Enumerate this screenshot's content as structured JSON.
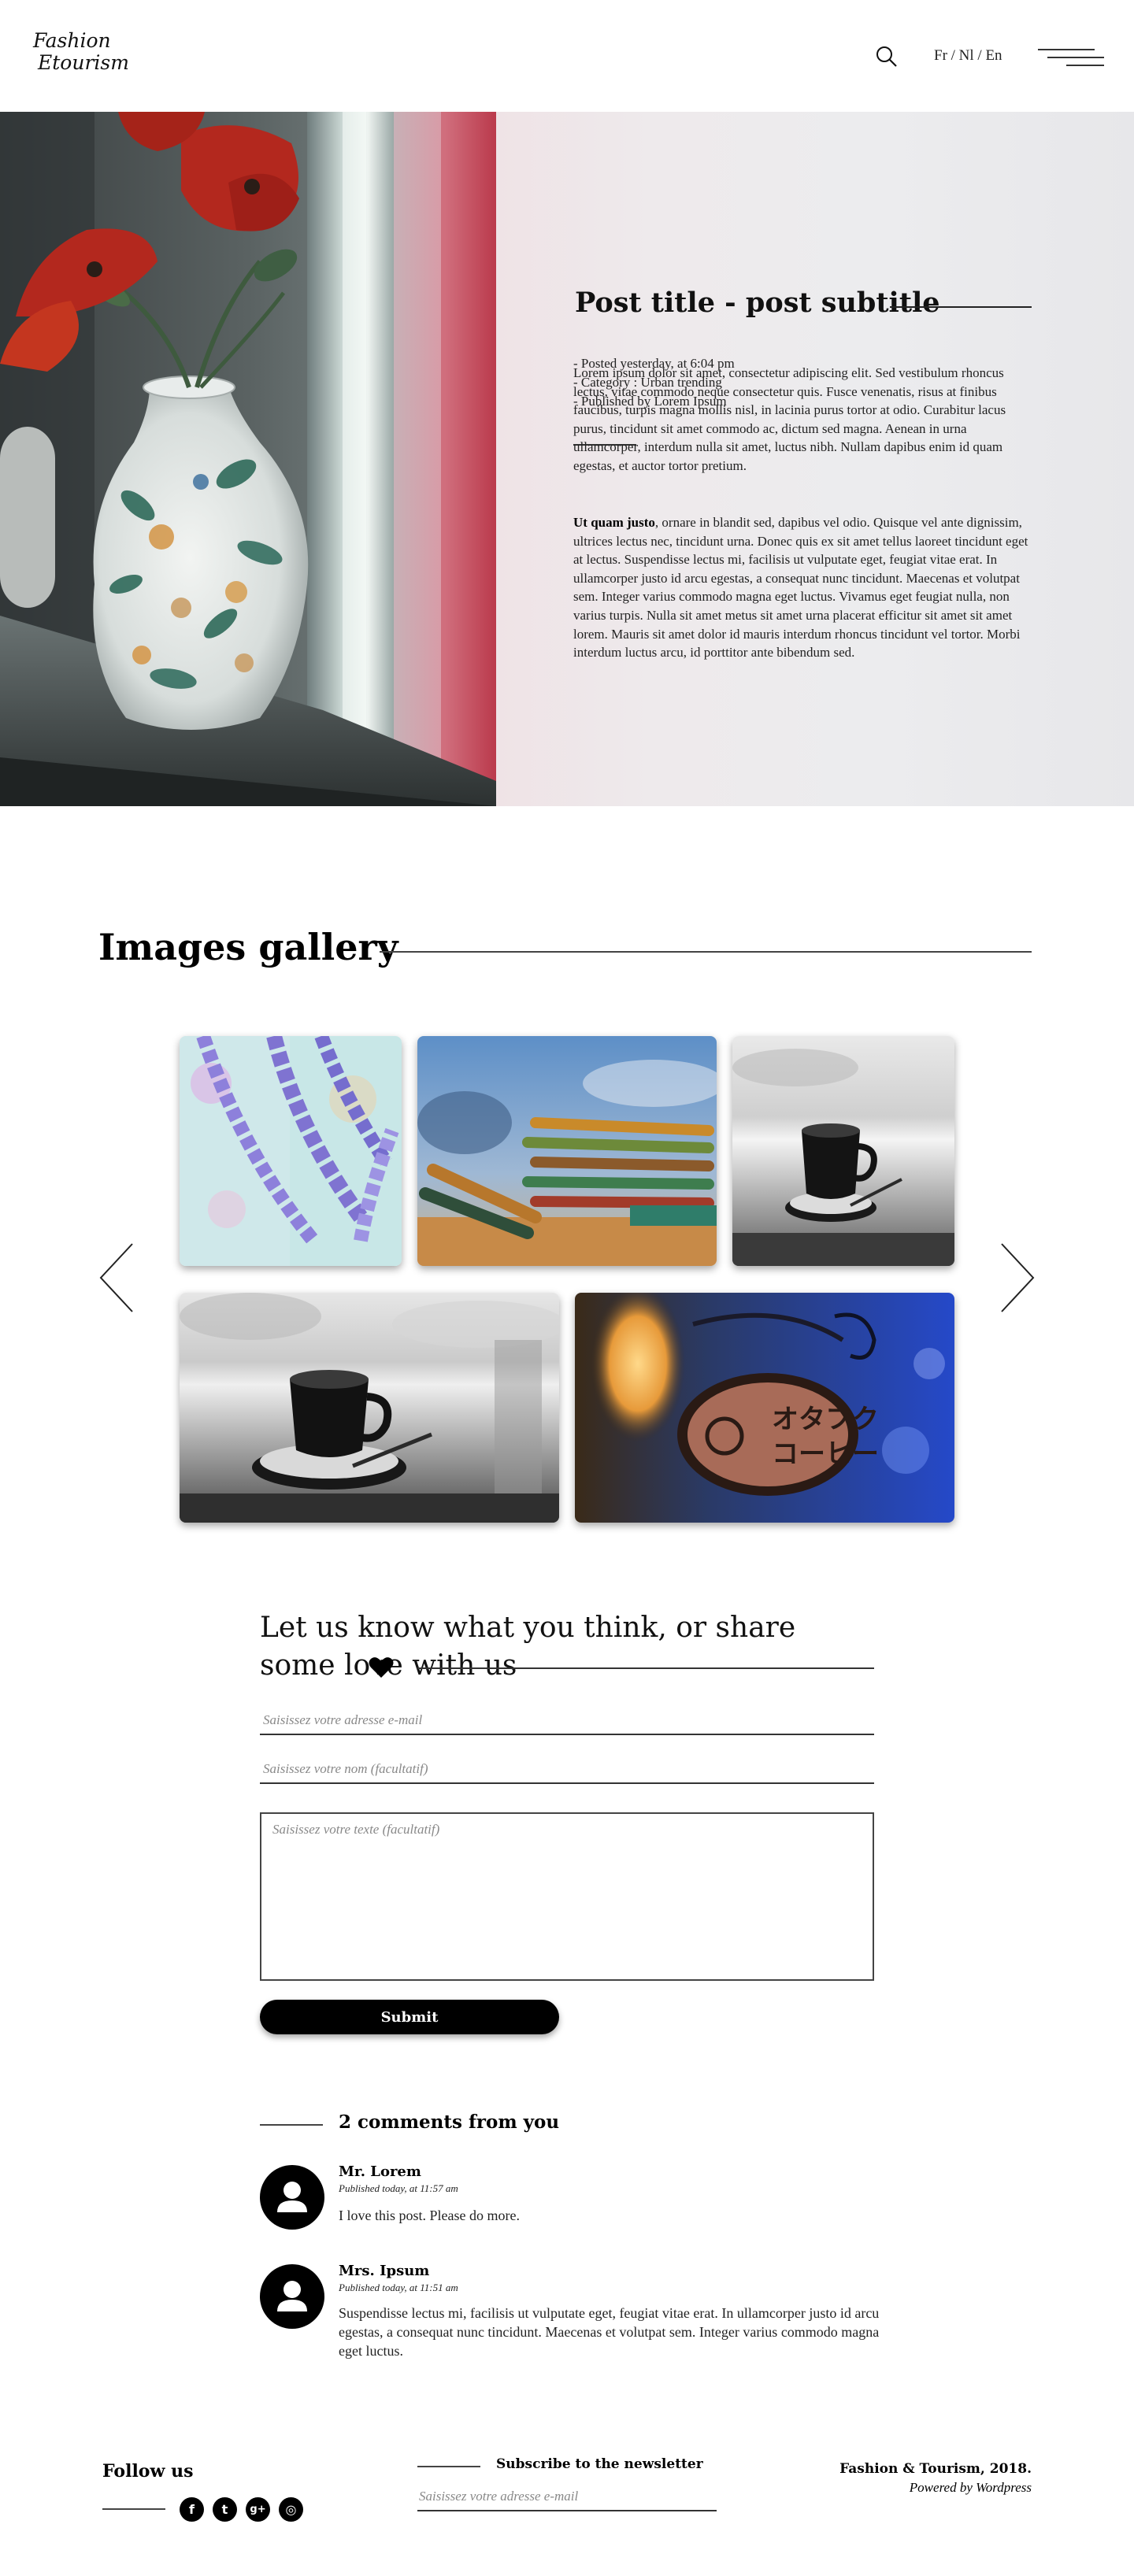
{
  "header": {
    "logo_line1": "Fashion",
    "logo_line2": "Etourism",
    "search_icon": "search-icon",
    "lang": "Fr / Nl / En",
    "menu_icon": "hamburger-menu-icon"
  },
  "post": {
    "title": "Post title - post subtitle",
    "meta": [
      "- Posted yesterday, at 6:04 pm",
      "- Category : Urban trending",
      "- Published by Lorem Ipsum"
    ],
    "paragraph1": "Lorem ipsum dolor sit amet, consectetur adipiscing elit. Sed vestibulum rhoncus lectus, vitae commodo neque consectetur quis. Fusce venenatis, risus at finibus faucibus, turpis magna mollis nisl, in lacinia purus tortor at odio. Curabitur lacus purus, tincidunt sit amet commodo ac, dictum sed magna. Aenean in urna ullamcorper, interdum nulla sit amet, luctus nibh. Nullam dapibus enim id quam egestas, et auctor tortor pretium.",
    "paragraph2_bold": "Ut quam justo",
    "paragraph2": ", ornare in blandit sed, dapibus vel odio. Quisque vel ante dignissim, ultrices lectus nec, tincidunt urna. Donec quis ex sit amet tellus laoreet tincidunt eget at lectus. Suspendisse lectus mi, facilisis ut vulputate eget, feugiat vitae erat. In ullamcorper justo id arcu egestas, a consequat nunc tincidunt. Maecenas et volutpat sem. Integer varius commodo magna eget luctus. Vivamus eget feugiat nulla, non varius turpis. Nulla sit amet metus sit amet urna placerat efficitur sit amet sit amet lorem. Mauris sit amet dolor id mauris interdum rhoncus tincidunt vel tortor. Morbi interdum luctus arcu, id porttitor ante bibendum sed."
  },
  "gallery": {
    "title": "Images gallery",
    "prev_icon": "chevron-left-icon",
    "next_icon": "chevron-right-icon",
    "images": [
      "purple beads necklace",
      "colored pencils",
      "coffee cup black and white",
      "coffee cup black and white",
      "coffee shop sign"
    ],
    "sign_text_line1": "オタフク",
    "sign_text_line2": "コーヒー"
  },
  "comment_form": {
    "title": "Let us know what you think, or share some love with us",
    "heart_icon": "heart-icon",
    "email_placeholder": "Saisissez votre adresse e-mail",
    "name_placeholder": "Saisissez votre nom (facultatif)",
    "text_placeholder": "Saisissez votre texte (facultatif)",
    "submit_label": "Submit"
  },
  "comments": {
    "title": "2 comments from you",
    "items": [
      {
        "name": "Mr. Lorem",
        "date": "Published today, at 11:57 am",
        "text": "I love this post. Please do more."
      },
      {
        "name": "Mrs. Ipsum",
        "date": "Published today, at 11:51 am",
        "text": "Suspendisse lectus mi, facilisis ut vulputate eget, feugiat vitae erat. In ullamcorper justo id arcu egestas, a consequat nunc tincidunt. Maecenas et volutpat sem. Integer varius commodo magna eget luctus."
      }
    ]
  },
  "footer": {
    "follow_title": "Follow us",
    "social": [
      {
        "icon": "facebook-icon",
        "glyph": "f"
      },
      {
        "icon": "twitter-icon",
        "glyph": "t"
      },
      {
        "icon": "google-plus-icon",
        "glyph": "g+"
      },
      {
        "icon": "instagram-icon",
        "glyph": "◎"
      }
    ],
    "newsletter_title": "Subscribe to the newsletter",
    "newsletter_placeholder": "Saisissez votre adresse e-mail",
    "copyright": "Fashion & Tourism, 2018.",
    "powered": "Powered by Wordpress"
  },
  "colors": {
    "text": "#111111",
    "button": "#000000",
    "hero_panel": "#ececee"
  }
}
